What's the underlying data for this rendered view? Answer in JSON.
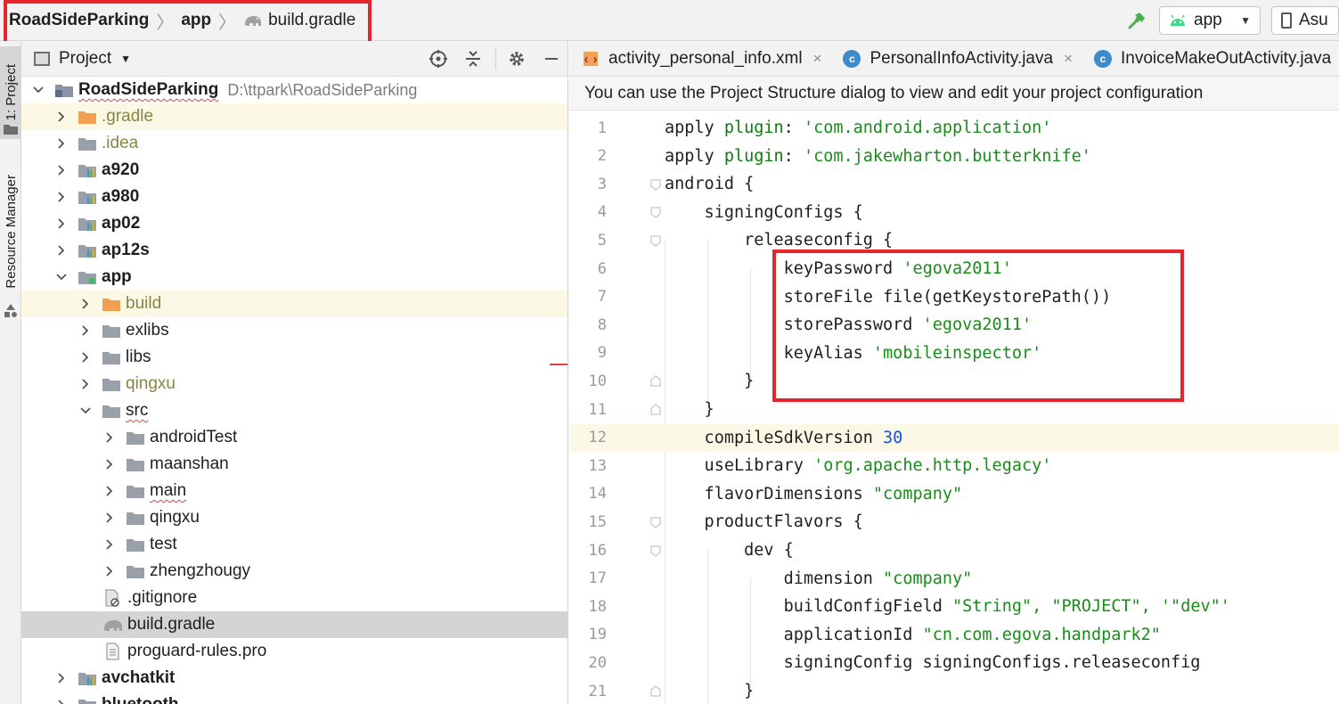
{
  "breadcrumbs": {
    "project": "RoadSideParking",
    "module": "app",
    "file": "build.gradle"
  },
  "toolbar": {
    "run_config": "app",
    "device_partial": "Asu"
  },
  "left_strip": {
    "project_tab": "1: Project",
    "resource_tab": "Resource Manager"
  },
  "project_panel": {
    "title": "Project",
    "tree": [
      {
        "label": "RoadSideParking",
        "path": "D:\\ttpark\\RoadSideParking"
      },
      {
        "label": ".gradle"
      },
      {
        "label": ".idea"
      },
      {
        "label": "a920"
      },
      {
        "label": "a980"
      },
      {
        "label": "ap02"
      },
      {
        "label": "ap12s"
      },
      {
        "label": "app"
      },
      {
        "label": "build"
      },
      {
        "label": "exlibs"
      },
      {
        "label": "libs"
      },
      {
        "label": "qingxu"
      },
      {
        "label": "src"
      },
      {
        "label": "androidTest"
      },
      {
        "label": "maanshan"
      },
      {
        "label": "main"
      },
      {
        "label": "qingxu"
      },
      {
        "label": "test"
      },
      {
        "label": "zhengzhougy"
      },
      {
        "label": ".gitignore"
      },
      {
        "label": "build.gradle"
      },
      {
        "label": "proguard-rules.pro"
      },
      {
        "label": "avchatkit"
      },
      {
        "label": "bluetooth"
      }
    ]
  },
  "editor": {
    "tabs": [
      {
        "label": "activity_personal_info.xml",
        "close": "×"
      },
      {
        "label": "PersonalInfoActivity.java",
        "close": "×"
      },
      {
        "label": "InvoiceMakeOutActivity.java",
        "close": ""
      }
    ],
    "banner": "You can use the Project Structure dialog to view and edit your project configuration",
    "lines": [
      {
        "n": "1",
        "a": "apply ",
        "b": "plugin",
        "c": ": ",
        "d": "'com.android.application'",
        "e": ""
      },
      {
        "n": "2",
        "a": "apply ",
        "b": "plugin",
        "c": ": ",
        "d": "'com.jakewharton.butterknife'",
        "e": ""
      },
      {
        "n": "3",
        "a": "android {",
        "b": "",
        "c": "",
        "d": "",
        "e": ""
      },
      {
        "n": "4",
        "a": "    signingConfigs {",
        "b": "",
        "c": "",
        "d": "",
        "e": ""
      },
      {
        "n": "5",
        "a": "        releaseconfig {",
        "b": "",
        "c": "",
        "d": "",
        "e": ""
      },
      {
        "n": "6",
        "a": "            keyPassword ",
        "b": "",
        "c": "",
        "d": "'egova2011'",
        "e": ""
      },
      {
        "n": "7",
        "a": "            storeFile file(getKeystorePath())",
        "b": "",
        "c": "",
        "d": "",
        "e": ""
      },
      {
        "n": "8",
        "a": "            storePassword ",
        "b": "",
        "c": "",
        "d": "'egova2011'",
        "e": ""
      },
      {
        "n": "9",
        "a": "            keyAlias ",
        "b": "",
        "c": "",
        "d": "'mobileinspector'",
        "e": ""
      },
      {
        "n": "10",
        "a": "        }",
        "b": "",
        "c": "",
        "d": "",
        "e": ""
      },
      {
        "n": "11",
        "a": "    }",
        "b": "",
        "c": "",
        "d": "",
        "e": ""
      },
      {
        "n": "12",
        "a": "    compileSdkVersion ",
        "b": "",
        "c": "",
        "d": "",
        "e": "30"
      },
      {
        "n": "13",
        "a": "    useLibrary ",
        "b": "",
        "c": "",
        "d": "'org.apache.http.legacy'",
        "e": ""
      },
      {
        "n": "14",
        "a": "    flavorDimensions ",
        "b": "",
        "c": "",
        "d": "\"company\"",
        "e": ""
      },
      {
        "n": "15",
        "a": "    productFlavors {",
        "b": "",
        "c": "",
        "d": "",
        "e": ""
      },
      {
        "n": "16",
        "a": "        dev {",
        "b": "",
        "c": "",
        "d": "",
        "e": ""
      },
      {
        "n": "17",
        "a": "            dimension ",
        "b": "",
        "c": "",
        "d": "\"company\"",
        "e": ""
      },
      {
        "n": "18",
        "a": "            buildConfigField ",
        "b": "",
        "c": "",
        "d": "\"String\", \"PROJECT\", '\"dev\"'",
        "e": ""
      },
      {
        "n": "19",
        "a": "            applicationId ",
        "b": "",
        "c": "",
        "d": "\"cn.com.egova.handpark2\"",
        "e": ""
      },
      {
        "n": "20",
        "a": "            signingConfig signingConfigs.releaseconfig",
        "b": "",
        "c": "",
        "d": "",
        "e": ""
      },
      {
        "n": "21",
        "a": "        }",
        "b": "",
        "c": "",
        "d": "",
        "e": ""
      }
    ]
  },
  "colors": {
    "highlight_box": "#e8242c",
    "string": "#1a8c1a",
    "number": "#1750eb",
    "current_line": "#fbf9e6",
    "selection": "#d4d4d4"
  }
}
